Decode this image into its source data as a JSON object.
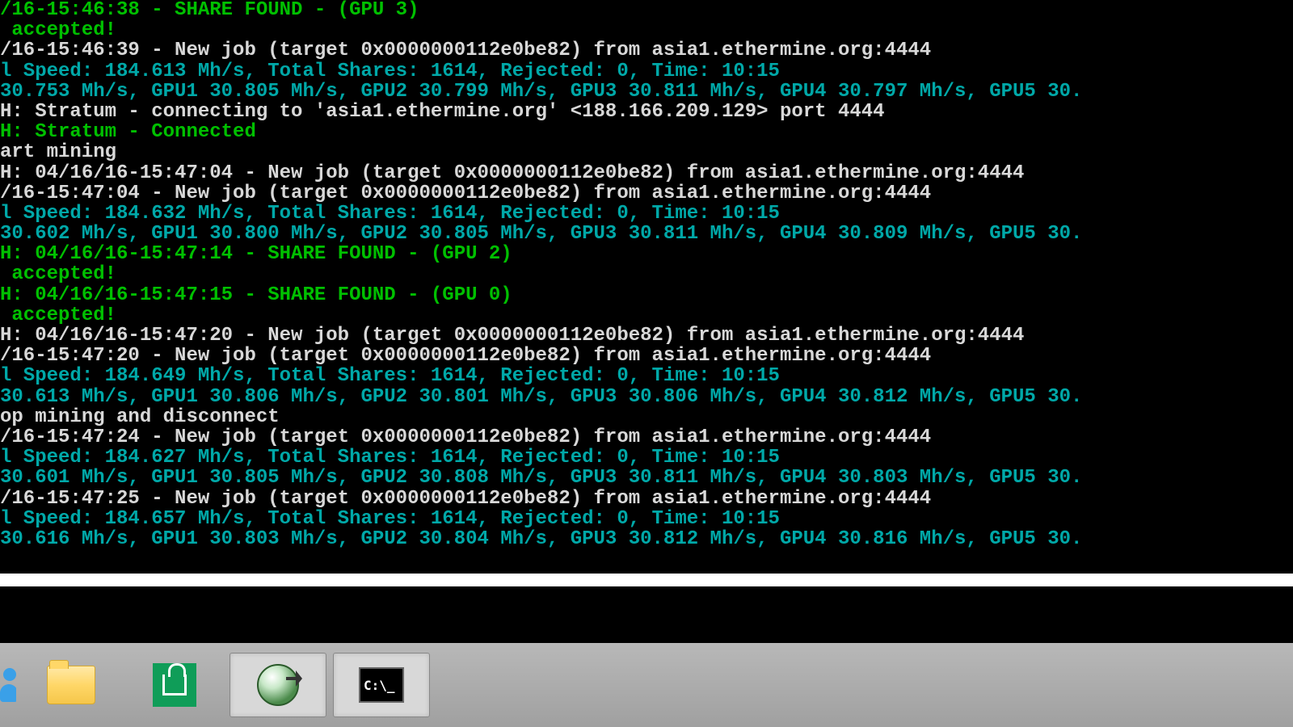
{
  "colors": {
    "green": "#00c000",
    "cyan": "#00a8a8",
    "white": "#d8d8d8"
  },
  "lines": [
    {
      "cls": "green",
      "text": "/16-15:46:38 - SHARE FOUND - (GPU 3)"
    },
    {
      "cls": "green",
      "text": " accepted!"
    },
    {
      "cls": "white",
      "text": "/16-15:46:39 - New job (target 0x0000000112e0be82) from asia1.ethermine.org:4444"
    },
    {
      "cls": "cyan",
      "text": "l Speed: 184.613 Mh/s, Total Shares: 1614, Rejected: 0, Time: 10:15"
    },
    {
      "cls": "cyan",
      "text": "30.753 Mh/s, GPU1 30.805 Mh/s, GPU2 30.799 Mh/s, GPU3 30.811 Mh/s, GPU4 30.797 Mh/s, GPU5 30."
    },
    {
      "cls": "white",
      "text": "H: Stratum - connecting to 'asia1.ethermine.org' <188.166.209.129> port 4444"
    },
    {
      "cls": "green",
      "text": "H: Stratum - Connected"
    },
    {
      "cls": "white",
      "text": "art mining"
    },
    {
      "cls": "white",
      "text": "H: 04/16/16-15:47:04 - New job (target 0x0000000112e0be82) from asia1.ethermine.org:4444"
    },
    {
      "cls": "white",
      "text": "/16-15:47:04 - New job (target 0x0000000112e0be82) from asia1.ethermine.org:4444"
    },
    {
      "cls": "cyan",
      "text": "l Speed: 184.632 Mh/s, Total Shares: 1614, Rejected: 0, Time: 10:15"
    },
    {
      "cls": "cyan",
      "text": "30.602 Mh/s, GPU1 30.800 Mh/s, GPU2 30.805 Mh/s, GPU3 30.811 Mh/s, GPU4 30.809 Mh/s, GPU5 30."
    },
    {
      "cls": "green",
      "text": "H: 04/16/16-15:47:14 - SHARE FOUND - (GPU 2)"
    },
    {
      "cls": "green",
      "text": " accepted!"
    },
    {
      "cls": "green",
      "text": "H: 04/16/16-15:47:15 - SHARE FOUND - (GPU 0)"
    },
    {
      "cls": "green",
      "text": " accepted!"
    },
    {
      "cls": "white",
      "text": "H: 04/16/16-15:47:20 - New job (target 0x0000000112e0be82) from asia1.ethermine.org:4444"
    },
    {
      "cls": "white",
      "text": "/16-15:47:20 - New job (target 0x0000000112e0be82) from asia1.ethermine.org:4444"
    },
    {
      "cls": "cyan",
      "text": "l Speed: 184.649 Mh/s, Total Shares: 1614, Rejected: 0, Time: 10:15"
    },
    {
      "cls": "cyan",
      "text": "30.613 Mh/s, GPU1 30.806 Mh/s, GPU2 30.801 Mh/s, GPU3 30.806 Mh/s, GPU4 30.812 Mh/s, GPU5 30."
    },
    {
      "cls": "white",
      "text": "op mining and disconnect"
    },
    {
      "cls": "white",
      "text": "/16-15:47:24 - New job (target 0x0000000112e0be82) from asia1.ethermine.org:4444"
    },
    {
      "cls": "cyan",
      "text": "l Speed: 184.627 Mh/s, Total Shares: 1614, Rejected: 0, Time: 10:15"
    },
    {
      "cls": "cyan",
      "text": "30.601 Mh/s, GPU1 30.805 Mh/s, GPU2 30.808 Mh/s, GPU3 30.811 Mh/s, GPU4 30.803 Mh/s, GPU5 30."
    },
    {
      "cls": "white",
      "text": "/16-15:47:25 - New job (target 0x0000000112e0be82) from asia1.ethermine.org:4444"
    },
    {
      "cls": "cyan",
      "text": "l Speed: 184.657 Mh/s, Total Shares: 1614, Rejected: 0, Time: 10:15"
    },
    {
      "cls": "cyan",
      "text": "30.616 Mh/s, GPU1 30.803 Mh/s, GPU2 30.804 Mh/s, GPU3 30.812 Mh/s, GPU4 30.816 Mh/s, GPU5 30."
    }
  ],
  "taskbar": {
    "items": [
      {
        "name": "people-app",
        "icon": "person-icon"
      },
      {
        "name": "file-explorer",
        "icon": "folder-icon"
      },
      {
        "name": "windows-store",
        "icon": "store-icon"
      },
      {
        "name": "app-launcher",
        "icon": "globe-icon"
      },
      {
        "name": "command-prompt",
        "icon": "cmd-icon"
      }
    ],
    "cmd_label": "C:\\_"
  }
}
